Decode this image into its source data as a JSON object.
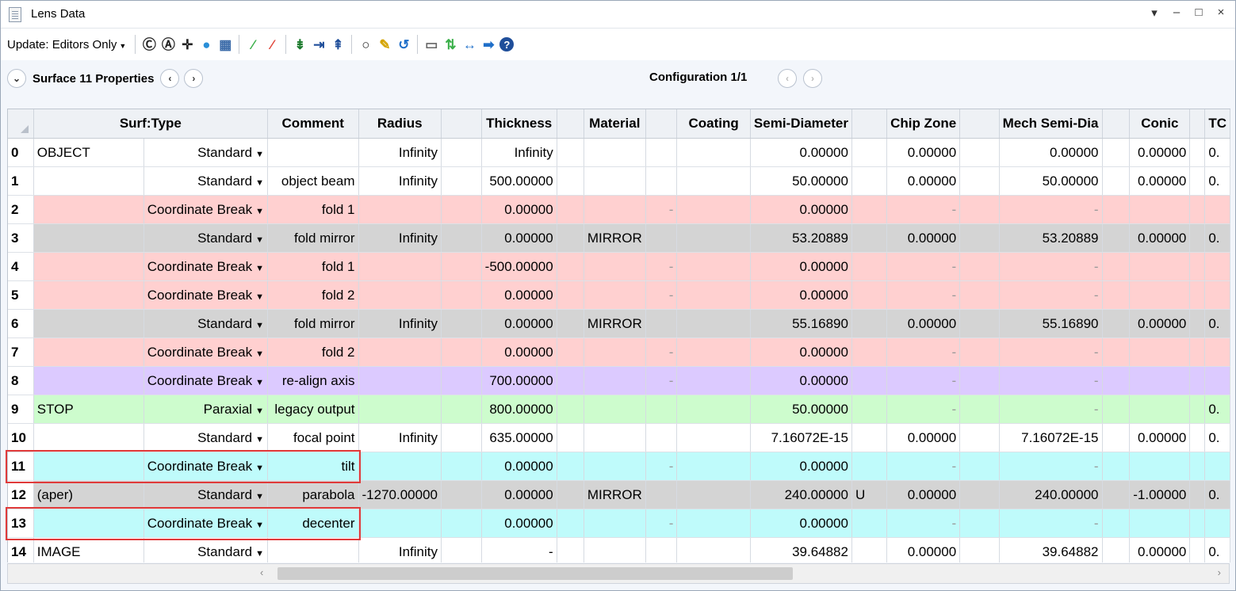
{
  "window": {
    "title": "Lens Data",
    "controls": [
      "▾",
      "–",
      "□",
      "×"
    ]
  },
  "toolbar": {
    "update_label": "Update: Editors Only",
    "icons": [
      {
        "name": "calculator-icon",
        "glyph": "Ⓒ",
        "color": "#222"
      },
      {
        "name": "calculator-alt-icon",
        "glyph": "Ⓐ",
        "color": "#222"
      },
      {
        "name": "crosshair-icon",
        "glyph": "✛",
        "color": "#222"
      },
      {
        "name": "globe-icon",
        "glyph": "●",
        "color": "#2a8fd8"
      },
      {
        "name": "image-icon",
        "glyph": "▦",
        "color": "#3a6aa8"
      },
      {
        "name": "ray-icon-1",
        "glyph": "⁄",
        "color": "#3bb04a"
      },
      {
        "name": "ray-icon-2",
        "glyph": "⁄",
        "color": "#e0463a"
      },
      {
        "name": "lens-icon-1",
        "glyph": "⇟",
        "color": "#1a7a2c"
      },
      {
        "name": "lens-icon-2",
        "glyph": "⇥",
        "color": "#1f4e9a"
      },
      {
        "name": "lens-icon-3",
        "glyph": "⇞",
        "color": "#1f4e9a"
      },
      {
        "name": "aperture-icon",
        "glyph": "○",
        "color": "#222"
      },
      {
        "name": "edit-icon",
        "glyph": "✎",
        "color": "#d4a300"
      },
      {
        "name": "undo-icon",
        "glyph": "↺",
        "color": "#1f6fc9"
      },
      {
        "name": "document-icon",
        "glyph": "▭",
        "color": "#666"
      },
      {
        "name": "swap-icon",
        "glyph": "⇅",
        "color": "#3bb04a"
      },
      {
        "name": "collapse-icon",
        "glyph": "↔",
        "color": "#1f6fc9"
      },
      {
        "name": "arrow-right-icon",
        "glyph": "➡",
        "color": "#1f6fc9"
      },
      {
        "name": "help-icon",
        "glyph": "?",
        "color": "#1f4e9a"
      }
    ]
  },
  "properties_bar": {
    "label": "Surface  11 Properties",
    "configuration": "Configuration 1/1"
  },
  "table": {
    "columns": [
      "Surf:Type",
      "Comment",
      "Radius",
      "",
      "Thickness",
      "",
      "Material",
      "",
      "Coating",
      "Semi-Diameter",
      "",
      "Chip Zone",
      "",
      "Mech Semi-Dia",
      "",
      "Conic",
      "",
      "TC"
    ],
    "rows": [
      {
        "cls": "",
        "num": "0",
        "name": "OBJECT",
        "type": "Standard",
        "comment": "",
        "radius": "Infinity",
        "thickness": "Infinity",
        "material": "",
        "matdash": false,
        "coating": "",
        "semi": "0.00000",
        "semiflag": "",
        "chip": "0.00000",
        "mech": "0.00000",
        "conic": "0.00000",
        "tc": "0."
      },
      {
        "cls": "",
        "num": "1",
        "name": "",
        "type": "Standard",
        "comment": "object beam",
        "radius": "Infinity",
        "thickness": "500.00000",
        "material": "",
        "matdash": false,
        "coating": "",
        "semi": "50.00000",
        "semiflag": "",
        "chip": "0.00000",
        "mech": "50.00000",
        "conic": "0.00000",
        "tc": "0."
      },
      {
        "cls": "cb",
        "num": "2",
        "name": "",
        "type": "Coordinate Break",
        "comment": "fold 1",
        "radius": "",
        "thickness": "0.00000",
        "material": "",
        "matdash": true,
        "coating": "",
        "semi": "0.00000",
        "semiflag": "",
        "chip": "-",
        "mech": "-",
        "conic": "",
        "tc": ""
      },
      {
        "cls": "gray",
        "num": "3",
        "name": "",
        "type": "Standard",
        "comment": "fold mirror",
        "radius": "Infinity",
        "thickness": "0.00000",
        "material": "MIRROR",
        "matdash": false,
        "coating": "",
        "semi": "53.20889",
        "semiflag": "",
        "chip": "0.00000",
        "mech": "53.20889",
        "conic": "0.00000",
        "tc": "0."
      },
      {
        "cls": "cb",
        "num": "4",
        "name": "",
        "type": "Coordinate Break",
        "comment": "fold 1",
        "radius": "",
        "thickness": "-500.00000",
        "material": "",
        "matdash": true,
        "coating": "",
        "semi": "0.00000",
        "semiflag": "",
        "chip": "-",
        "mech": "-",
        "conic": "",
        "tc": ""
      },
      {
        "cls": "cb",
        "num": "5",
        "name": "",
        "type": "Coordinate Break",
        "comment": "fold 2",
        "radius": "",
        "thickness": "0.00000",
        "material": "",
        "matdash": true,
        "coating": "",
        "semi": "0.00000",
        "semiflag": "",
        "chip": "-",
        "mech": "-",
        "conic": "",
        "tc": ""
      },
      {
        "cls": "gray",
        "num": "6",
        "name": "",
        "type": "Standard",
        "comment": "fold mirror",
        "radius": "Infinity",
        "thickness": "0.00000",
        "material": "MIRROR",
        "matdash": false,
        "coating": "",
        "semi": "55.16890",
        "semiflag": "",
        "chip": "0.00000",
        "mech": "55.16890",
        "conic": "0.00000",
        "tc": "0."
      },
      {
        "cls": "cb",
        "num": "7",
        "name": "",
        "type": "Coordinate Break",
        "comment": "fold 2",
        "radius": "",
        "thickness": "0.00000",
        "material": "",
        "matdash": true,
        "coating": "",
        "semi": "0.00000",
        "semiflag": "",
        "chip": "-",
        "mech": "-",
        "conic": "",
        "tc": ""
      },
      {
        "cls": "purple",
        "num": "8",
        "name": "",
        "type": "Coordinate Break",
        "comment": "re-align axis",
        "radius": "",
        "thickness": "700.00000",
        "material": "",
        "matdash": true,
        "coating": "",
        "semi": "0.00000",
        "semiflag": "",
        "chip": "-",
        "mech": "-",
        "conic": "",
        "tc": ""
      },
      {
        "cls": "green",
        "num": "9",
        "name": "STOP",
        "type": "Paraxial",
        "comment": "legacy output",
        "radius": "",
        "thickness": "800.00000",
        "material": "",
        "matdash": false,
        "coating": "",
        "semi": "50.00000",
        "semiflag": "",
        "chip": "-",
        "mech": "-",
        "conic": "",
        "tc": "0."
      },
      {
        "cls": "",
        "num": "10",
        "name": "",
        "type": "Standard",
        "comment": "focal point",
        "radius": "Infinity",
        "thickness": "635.00000",
        "material": "",
        "matdash": false,
        "coating": "",
        "semi": "7.16072E-15",
        "semiflag": "",
        "chip": "0.00000",
        "mech": "7.16072E-15",
        "conic": "0.00000",
        "tc": "0."
      },
      {
        "cls": "cyan",
        "num": "11",
        "name": "",
        "type": "Coordinate Break",
        "comment": "tilt",
        "radius": "",
        "thickness": "0.00000",
        "material": "",
        "matdash": true,
        "coating": "",
        "semi": "0.00000",
        "semiflag": "",
        "chip": "-",
        "mech": "-",
        "conic": "",
        "tc": ""
      },
      {
        "cls": "gray",
        "num": "12",
        "name": "(aper)",
        "type": "Standard",
        "comment": "parabola",
        "radius": "-1270.00000",
        "thickness": "0.00000",
        "material": "MIRROR",
        "matdash": false,
        "coating": "",
        "semi": "240.00000",
        "semiflag": "U",
        "chip": "0.00000",
        "mech": "240.00000",
        "conic": "-1.00000",
        "tc": "0."
      },
      {
        "cls": "cyan",
        "num": "13",
        "name": "",
        "type": "Coordinate Break",
        "comment": "decenter",
        "radius": "",
        "thickness": "0.00000",
        "material": "",
        "matdash": true,
        "coating": "",
        "semi": "0.00000",
        "semiflag": "",
        "chip": "-",
        "mech": "-",
        "conic": "",
        "tc": ""
      },
      {
        "cls": "",
        "num": "14",
        "name": "IMAGE",
        "type": "Standard",
        "comment": "",
        "radius": "Infinity",
        "thickness": "-",
        "material": "",
        "matdash": false,
        "coating": "",
        "semi": "39.64882",
        "semiflag": "",
        "chip": "0.00000",
        "mech": "39.64882",
        "conic": "0.00000",
        "tc": "0."
      }
    ]
  }
}
